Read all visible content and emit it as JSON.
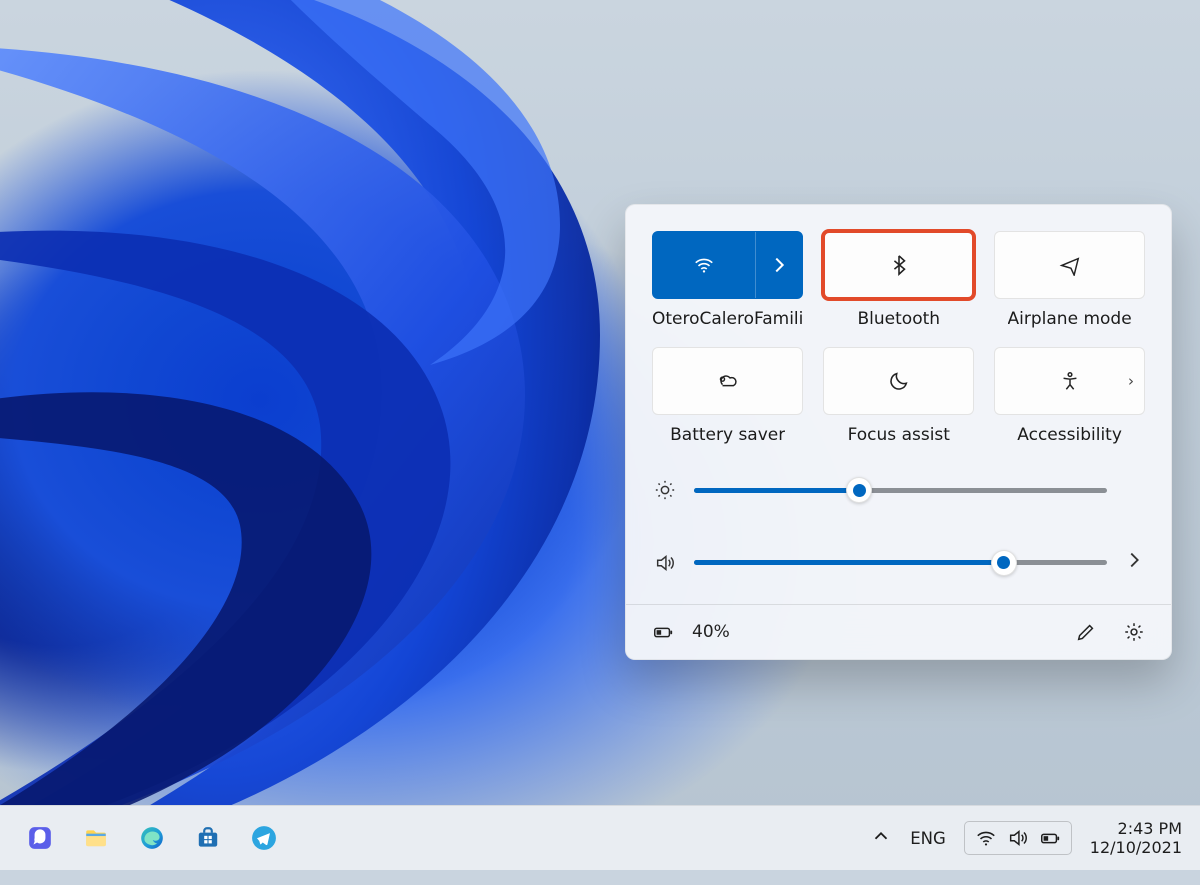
{
  "quick_settings": {
    "tiles": [
      {
        "key": "wifi",
        "label": "OteroCaleroFamili",
        "icon": "wifi-icon",
        "active": true,
        "split": true,
        "highlight": false
      },
      {
        "key": "bluetooth",
        "label": "Bluetooth",
        "icon": "bluetooth-icon",
        "active": false,
        "split": false,
        "highlight": true
      },
      {
        "key": "airplane",
        "label": "Airplane mode",
        "icon": "airplane-icon",
        "active": false,
        "split": false,
        "highlight": false
      },
      {
        "key": "battery-saver",
        "label": "Battery saver",
        "icon": "battery-saver-icon",
        "active": false,
        "split": false,
        "highlight": false
      },
      {
        "key": "focus-assist",
        "label": "Focus assist",
        "icon": "focus-assist-icon",
        "active": false,
        "split": false,
        "highlight": false
      },
      {
        "key": "accessibility",
        "label": "Accessibility",
        "icon": "accessibility-icon",
        "active": false,
        "split": false,
        "highlight": false,
        "chevron": true
      }
    ],
    "brightness_percent": 40,
    "volume_percent": 75,
    "battery_text": "40%"
  },
  "taskbar": {
    "apps": [
      {
        "name": "chat",
        "icon": "chat-app-icon"
      },
      {
        "name": "explorer",
        "icon": "folder-app-icon"
      },
      {
        "name": "edge",
        "icon": "edge-app-icon"
      },
      {
        "name": "store",
        "icon": "store-app-icon"
      },
      {
        "name": "telegram",
        "icon": "telegram-app-icon"
      }
    ],
    "tray": {
      "language": "ENG",
      "time": "2:43 PM",
      "date": "12/10/2021"
    }
  }
}
